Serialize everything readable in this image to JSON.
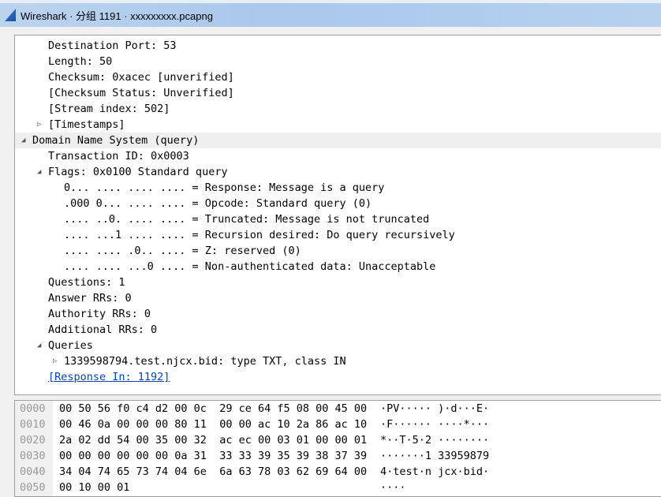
{
  "window": {
    "title": "Wireshark · 分组 1191 · xxxxxxxxx.pcapng"
  },
  "tree": [
    {
      "level": 1,
      "text": "Destination Port: 53"
    },
    {
      "level": 1,
      "text": "Length: 50"
    },
    {
      "level": 1,
      "text": "Checksum: 0xacec [unverified]"
    },
    {
      "level": 1,
      "text": "[Checksum Status: Unverified]"
    },
    {
      "level": 1,
      "text": "[Stream index: 502]"
    },
    {
      "level": 1,
      "text": "[Timestamps]",
      "toggle": "collapsed"
    },
    {
      "level": 0,
      "text": "Domain Name System (query)",
      "toggle": "expanded",
      "selected": true
    },
    {
      "level": 1,
      "text": "Transaction ID: 0x0003"
    },
    {
      "level": 1,
      "text": "Flags: 0x0100 Standard query",
      "toggle": "expanded"
    },
    {
      "level": 2,
      "text": "0... .... .... .... = Response: Message is a query"
    },
    {
      "level": 2,
      "text": ".000 0... .... .... = Opcode: Standard query (0)"
    },
    {
      "level": 2,
      "text": ".... ..0. .... .... = Truncated: Message is not truncated"
    },
    {
      "level": 2,
      "text": ".... ...1 .... .... = Recursion desired: Do query recursively"
    },
    {
      "level": 2,
      "text": ".... .... .0.. .... = Z: reserved (0)"
    },
    {
      "level": 2,
      "text": ".... .... ...0 .... = Non-authenticated data: Unacceptable"
    },
    {
      "level": 1,
      "text": "Questions: 1"
    },
    {
      "level": 1,
      "text": "Answer RRs: 0"
    },
    {
      "level": 1,
      "text": "Authority RRs: 0"
    },
    {
      "level": 1,
      "text": "Additional RRs: 0"
    },
    {
      "level": 1,
      "text": "Queries",
      "toggle": "expanded"
    },
    {
      "level": 2,
      "text": "1339598794.test.njcx.bid: type TXT, class IN",
      "toggle": "collapsed"
    },
    {
      "level": 1,
      "text": "[Response In: 1192]",
      "link": true
    }
  ],
  "hex": {
    "offsets": [
      "0000",
      "0010",
      "0020",
      "0030",
      "0040",
      "0050"
    ],
    "bytes": [
      "00 50 56 f0 c4 d2 00 0c  29 ce 64 f5 08 00 45 00",
      "00 46 0a 00 00 00 80 11  00 00 ac 10 2a 86 ac 10",
      "2a 02 dd 54 00 35 00 32  ac ec 00 03 01 00 00 01",
      "00 00 00 00 00 00 0a 31  33 33 39 35 39 38 37 39",
      "34 04 74 65 73 74 04 6e  6a 63 78 03 62 69 64 00",
      "00 10 00 01"
    ],
    "ascii": [
      "·PV····· )·d···E·",
      "·F······ ····*···",
      "*··T·5·2 ········",
      "·······1 33959879",
      "4·test·n jcx·bid·",
      "····"
    ]
  }
}
